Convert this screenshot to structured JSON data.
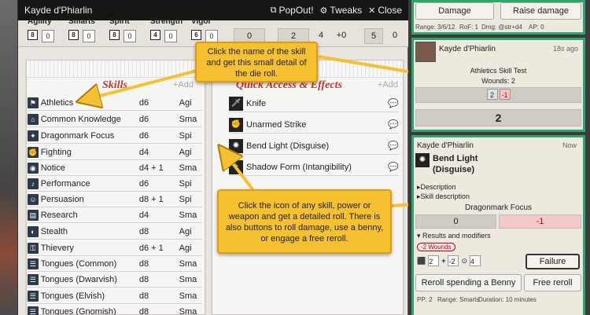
{
  "sheet": {
    "title": "Kayde d'Phiarlin",
    "popout_label": "PopOut!",
    "tweaks_label": "Tweaks",
    "close_label": "Close",
    "attributes": [
      {
        "label": "Agility",
        "die": "8",
        "value": "0"
      },
      {
        "label": "Smarts",
        "die": "8",
        "value": "0"
      },
      {
        "label": "Spirit",
        "die": "8",
        "value": "0"
      },
      {
        "label": "Strength",
        "die": "4",
        "value": "0"
      },
      {
        "label": "Vigor",
        "die": "6",
        "value": "0"
      }
    ],
    "stats": [
      "0",
      "2",
      "4",
      "+0",
      "5",
      "0"
    ],
    "skills_panel": {
      "title": "Skills",
      "add_label": "+Add",
      "skills": [
        {
          "name": "Athletics",
          "die": "d6",
          "attr": "Agi"
        },
        {
          "name": "Common Knowledge",
          "die": "d6",
          "attr": "Sma"
        },
        {
          "name": "Dragonmark Focus",
          "die": "d6",
          "attr": "Spi"
        },
        {
          "name": "Fighting",
          "die": "d4",
          "attr": "Agi"
        },
        {
          "name": "Notice",
          "die": "d4 + 1",
          "attr": "Sma"
        },
        {
          "name": "Performance",
          "die": "d6",
          "attr": "Spi"
        },
        {
          "name": "Persuasion",
          "die": "d8 + 1",
          "attr": "Spi"
        },
        {
          "name": "Research",
          "die": "d4",
          "attr": "Sma"
        },
        {
          "name": "Stealth",
          "die": "d8",
          "attr": "Agi"
        },
        {
          "name": "Thievery",
          "die": "d6 + 1",
          "attr": "Agi"
        },
        {
          "name": "Tongues (Common)",
          "die": "d8",
          "attr": "Sma"
        },
        {
          "name": "Tongues (Dwarvish)",
          "die": "d8",
          "attr": "Sma"
        },
        {
          "name": "Tongues (Elvish)",
          "die": "d8",
          "attr": "Sma"
        },
        {
          "name": "Tongues (Gnomish)",
          "die": "d8",
          "attr": "Sma"
        }
      ]
    },
    "quick_panel": {
      "title": "Quick Access & Effects",
      "add_label": "+Add",
      "items": [
        {
          "name": "Knife"
        },
        {
          "name": "Unarmed Strike"
        },
        {
          "name": "Bend Light (Disguise)"
        },
        {
          "name": "Shadow Form (Intangibility)"
        }
      ]
    }
  },
  "callouts": {
    "top": "Click the name of the skill and get this small detail of the die roll.",
    "bottom": "Click the icon of any skill, power or weapon and get a detailed roll. There is also buttons to roll damage, use a benny, or engage a free reroll."
  },
  "chat": {
    "card1": {
      "damage_label": "Damage",
      "raise_label": "Raise damage",
      "range": "Range: 3/6/12",
      "rof": "RoF: 1",
      "dmg": "Dmg: @str+d4",
      "ap": "AP: 0"
    },
    "card2": {
      "speaker": "Kayde d'Phiarlin",
      "time": "18s ago",
      "test_title": "Athletics Skill Test",
      "wounds": "Wounds:  2",
      "die_value": "2",
      "modifier": "-1",
      "total": "2"
    },
    "card3": {
      "speaker": "Kayde d'Phiarlin",
      "time": "Now",
      "power_name": "Bend Light (Disguise)",
      "description_label": "Description",
      "skill_description_label": "Skill description",
      "skill_name": "Dragonmark Focus",
      "roll_value": "0",
      "roll_mod": "-1",
      "results_label": "Results and modifiers",
      "wounds_badge": "-2 Wounds",
      "die_count": "2",
      "mod_value": "-2",
      "target": "4",
      "failure_label": "Failure",
      "reroll_benny_label": "Reroll spending a Benny",
      "free_reroll_label": "Free reroll",
      "pp": "PP: 2",
      "range": "Range: Smarts",
      "duration": "Duration: 10 minutes"
    }
  }
}
